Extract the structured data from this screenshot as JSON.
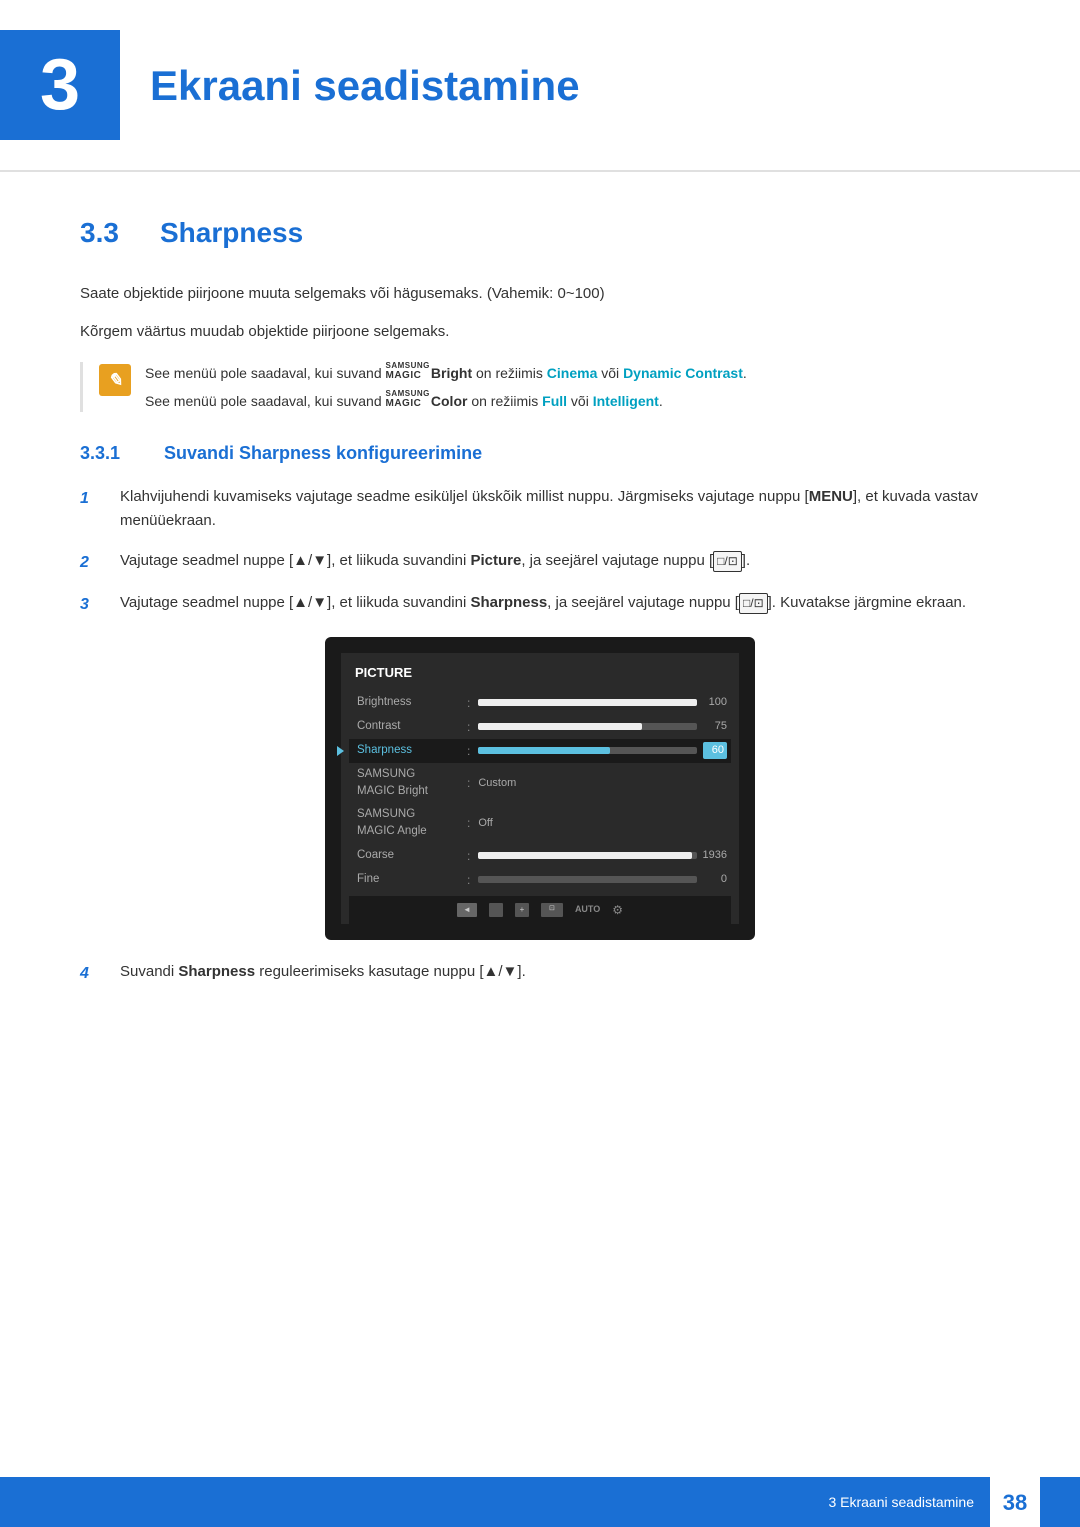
{
  "chapter": {
    "number": "3",
    "title": "Ekraani seadistamine"
  },
  "section": {
    "number": "3.3",
    "title": "Sharpness"
  },
  "body_text_1": "Saate objektide piirjoone muuta selgemaks või hägusemaks. (Vahemik: 0~100)",
  "body_text_2": "Kõrgem väärtus muudab objektide piirjoone selgemaks.",
  "notes": [
    {
      "text_parts": [
        "See menüü pole saadaval, kui suvand ",
        "SAMSUNG MAGIC",
        "Bright",
        " on režiimis ",
        "Cinema",
        " või ",
        "Dynamic Contrast",
        "."
      ]
    },
    {
      "text_parts": [
        "See menüü pole saadaval, kui suvand ",
        "SAMSUNG MAGIC",
        "Color",
        " on režiimis ",
        "Full",
        " või ",
        "Intelligent",
        "."
      ]
    }
  ],
  "subsection": {
    "number": "3.3.1",
    "title": "Suvandi Sharpness konfigureerimine"
  },
  "steps": [
    {
      "number": "1",
      "text": "Klahvijuhendi kuvamiseks vajutage seadme esiküljel ükskõik millist nuppu. Järgmiseks vajutage nuppu [MENU], et kuvada vastav menüüekraan."
    },
    {
      "number": "2",
      "text": "Vajutage seadmel nuppe [▲/▼], et liikuda suvandini Picture, ja seejärel vajutage nuppu [□/□]."
    },
    {
      "number": "3",
      "text": "Vajutage seadmel nuppe [▲/▼], et liikuda suvandini Sharpness, ja seejärel vajutage nuppu [□/□]. Kuvatakse järgmine ekraan."
    },
    {
      "number": "4",
      "text": "Suvandi Sharpness reguleerimiseks kasutage nuppu [▲/▼]."
    }
  ],
  "monitor_menu": {
    "header": "PICTURE",
    "items": [
      {
        "label": "Brightness",
        "type": "bar",
        "fill_pct": 100,
        "value": "100",
        "selected": false
      },
      {
        "label": "Contrast",
        "type": "bar",
        "fill_pct": 75,
        "value": "75",
        "selected": false
      },
      {
        "label": "Sharpness",
        "type": "bar",
        "fill_pct": 60,
        "value": "60",
        "selected": true
      },
      {
        "label": "SAMSUNG MAGIC Bright",
        "type": "text",
        "value": "Custom",
        "selected": false
      },
      {
        "label": "SAMSUNG MAGIC Angle",
        "type": "text",
        "value": "Off",
        "selected": false
      },
      {
        "label": "Coarse",
        "type": "bar",
        "fill_pct": 99,
        "value": "1936",
        "selected": false
      },
      {
        "label": "Fine",
        "type": "bar",
        "fill_pct": 0,
        "value": "0",
        "selected": false
      }
    ]
  },
  "footer": {
    "chapter_label": "3 Ekraani seadistamine",
    "page_number": "38"
  }
}
